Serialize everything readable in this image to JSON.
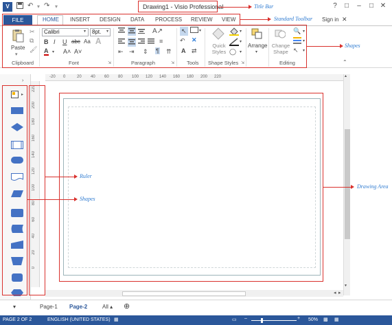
{
  "title_bar": {
    "app_logo": "V",
    "title": "Drawing1 - Visio Professional",
    "help": "?",
    "minimize": "–",
    "restore": "□",
    "close": "✕"
  },
  "quick_access": {
    "save": "💾",
    "undo": "↶",
    "redo": "↷"
  },
  "tabs": {
    "file": "FILE",
    "home": "HOME",
    "insert": "INSERT",
    "design": "DESIGN",
    "data": "DATA",
    "process": "PROCESS",
    "review": "REVIEW",
    "view": "VIEW",
    "sign_in": "Sign in",
    "close_ribbon": "✕"
  },
  "ribbon": {
    "clipboard": {
      "paste": "Paste",
      "label": "Clipboard"
    },
    "font": {
      "family": "Calibri",
      "size": "8pt.",
      "bold": "B",
      "italic": "I",
      "underline": "U",
      "strike": "abc",
      "case": "Aa",
      "color": "A",
      "grow": "A˄",
      "shrink": "A˅",
      "label": "Font"
    },
    "paragraph": {
      "label": "Paragraph"
    },
    "tools": {
      "label": "Tools",
      "text": "A"
    },
    "shape_styles": {
      "quick_styles": "Quick Styles",
      "label": "Shape Styles"
    },
    "arrange": {
      "arrange": "Arrange"
    },
    "editing": {
      "change_shape": "Change Shape",
      "label": "Editing"
    }
  },
  "ruler": {
    "h_ticks": [
      "-20",
      "0",
      "20",
      "40",
      "60",
      "80",
      "100",
      "120",
      "140",
      "160",
      "180",
      "200",
      "220"
    ],
    "v_ticks": [
      "220",
      "200",
      "180",
      "160",
      "140",
      "120",
      "100",
      "80",
      "60",
      "40",
      "20",
      "0"
    ]
  },
  "page_tabs": {
    "page1": "Page-1",
    "page2": "Page-2",
    "all": "All ▴",
    "add": "⊕"
  },
  "status_bar": {
    "page": "PAGE 2 OF 2",
    "language": "ENGLISH (UNITED STATES)",
    "zoom": "50%"
  },
  "annotations": {
    "title_bar": "Title Bar",
    "standard_toolbar": "Standard Toolbar",
    "shapes_ribbon": "Shapes",
    "ruler": "Ruler",
    "shapes": "Shapes",
    "drawing_area": "Drawing Area"
  },
  "colors": {
    "accent": "#2b579a",
    "annotation_border": "#d9302c",
    "annotation_text": "#2f7bd1"
  }
}
